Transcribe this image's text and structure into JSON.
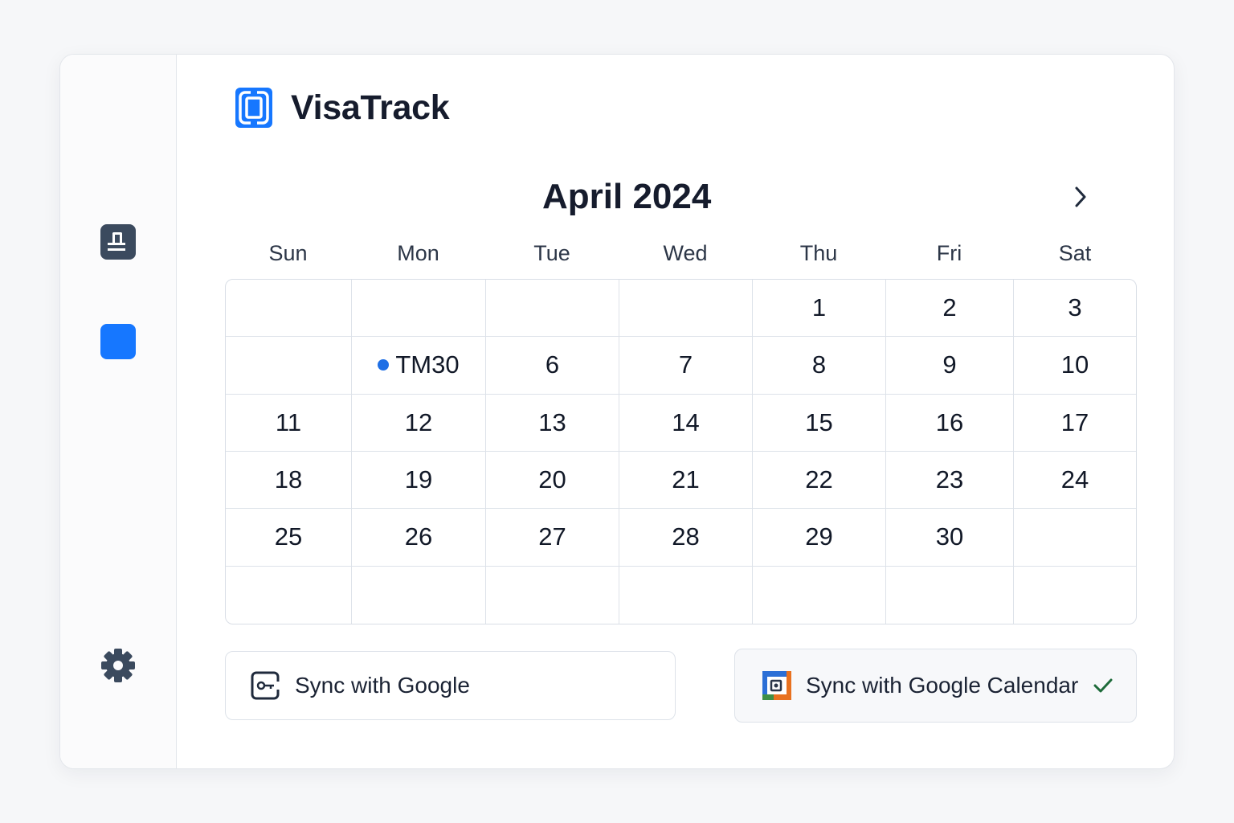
{
  "app": {
    "title": "VisaTrack",
    "brand_color": "#1677ff"
  },
  "sidebar": {
    "items": [
      {
        "name": "clipboard-icon",
        "color": "#3b4a5e"
      },
      {
        "name": "square-icon",
        "color": "#1677ff"
      },
      {
        "name": "gear-icon",
        "color": "#3b4a5e"
      }
    ]
  },
  "calendar": {
    "month_title": "April 2024",
    "weekdays": [
      "Sun",
      "Mon",
      "Tue",
      "Wed",
      "Thu",
      "Fri",
      "Sat"
    ],
    "cells": [
      "",
      "",
      "",
      "",
      "1",
      "2",
      "3",
      "",
      "TM30",
      "6",
      "7",
      "8",
      "9",
      "10",
      "11",
      "12",
      "13",
      "14",
      "15",
      "16",
      "17",
      "18",
      "19",
      "20",
      "21",
      "22",
      "23",
      "24",
      "25",
      "26",
      "27",
      "28",
      "29",
      "30",
      "",
      "",
      "",
      "",
      "",
      "",
      "",
      ""
    ],
    "event": {
      "label": "TM30",
      "dot_color": "#1f6fe5"
    }
  },
  "actions": {
    "sync_google_label": "Sync with Google",
    "sync_calendar_label": "Sync with Google Calendar",
    "check_color": "#1e6b3a"
  }
}
